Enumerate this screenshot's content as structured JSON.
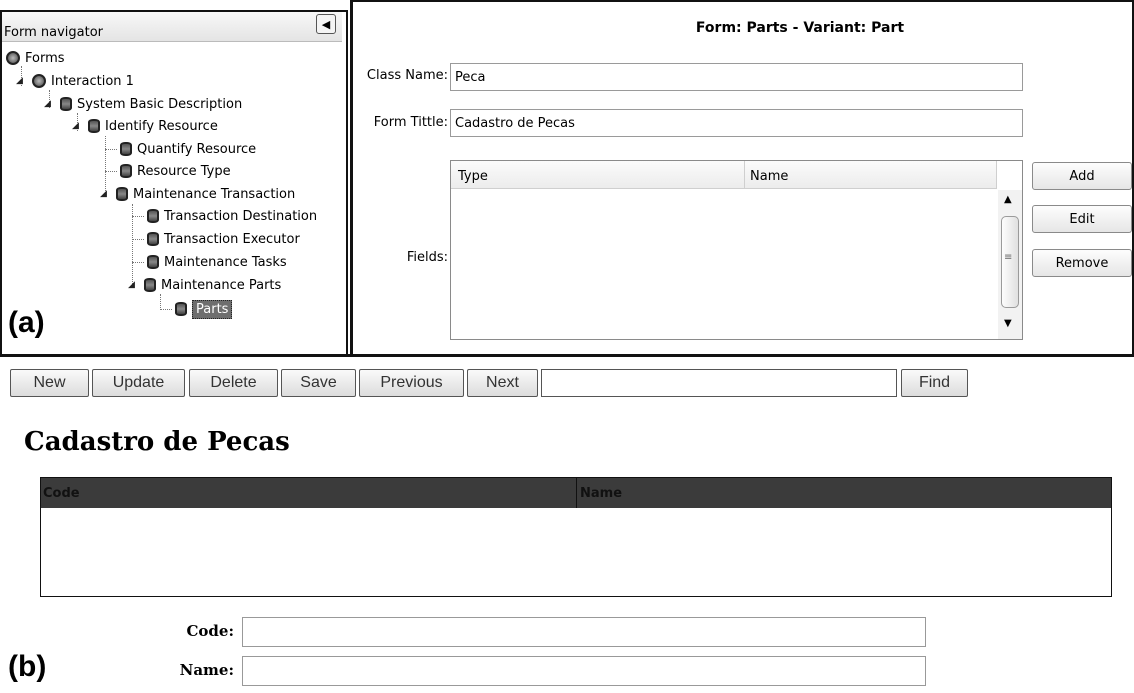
{
  "navigator": {
    "title": "Form navigator",
    "tree": [
      {
        "label": "Forms"
      },
      {
        "label": "Interaction 1"
      },
      {
        "label": "System Basic Description"
      },
      {
        "label": "Identify Resource"
      },
      {
        "label": "Quantify Resource"
      },
      {
        "label": "Resource Type"
      },
      {
        "label": "Maintenance Transaction"
      },
      {
        "label": "Transaction Destination"
      },
      {
        "label": "Transaction Executor"
      },
      {
        "label": "Maintenance Tasks"
      },
      {
        "label": "Maintenance Parts"
      },
      {
        "label": "Parts"
      }
    ]
  },
  "label_a": "(a)",
  "label_b": "(b)",
  "form": {
    "header": "Form: Parts - Variant: Part",
    "class_name_label": "Class Name:",
    "class_name_value": "Peca",
    "form_title_label": "Form Tittle:",
    "form_title_value": "Cadastro de Pecas",
    "fields_label": "Fields:",
    "columns": [
      "Type",
      "Name"
    ],
    "add_label": "Add",
    "edit_label": "Edit",
    "remove_label": "Remove"
  },
  "toolbar": {
    "new": "New",
    "update": "Update",
    "delete": "Delete",
    "save": "Save",
    "previous": "Previous",
    "next": "Next",
    "search_value": "",
    "find": "Find"
  },
  "generated": {
    "title": "Cadastro de Pecas",
    "columns": [
      "Code",
      "Name"
    ],
    "code_label": "Code:",
    "name_label": "Name:",
    "code_value": "",
    "name_value": ""
  }
}
